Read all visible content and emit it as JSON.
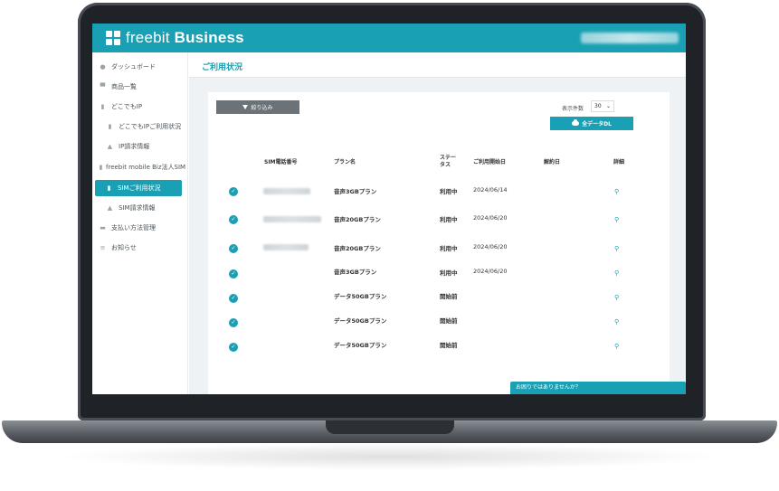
{
  "app": {
    "brand_light": "freebit",
    "brand_bold": "Business"
  },
  "sidebar": {
    "items": [
      {
        "label": "ダッシュボード",
        "icon": "dashboard-icon"
      },
      {
        "label": "商品一覧",
        "icon": "cart-icon"
      },
      {
        "label": "どこでもIP",
        "icon": "document-icon"
      },
      {
        "label": "どこでもIPご利用状況",
        "icon": "document-icon"
      },
      {
        "label": "IP請求情報",
        "icon": "coins-icon"
      },
      {
        "label": "freebit mobile Biz法人SIM",
        "icon": "document-icon"
      },
      {
        "label": "SIMご利用状況",
        "icon": "document-icon",
        "active": true
      },
      {
        "label": "SIM請求情報",
        "icon": "coins-icon"
      },
      {
        "label": "支払い方法管理",
        "icon": "card-icon"
      },
      {
        "label": "お知らせ",
        "icon": "list-icon"
      }
    ]
  },
  "page": {
    "title": "ご利用状況"
  },
  "toolbar": {
    "filter_label": "絞り込み",
    "perpage_label": "表示件数",
    "perpage_value": "30",
    "download_label": "全データDL"
  },
  "table": {
    "headers": {
      "phone": "SIM電話番号",
      "plan": "プラン名",
      "status_line1": "ステー",
      "status_line2": "タス",
      "start": "ご利用開始日",
      "end": "解約日",
      "detail": "詳細"
    },
    "rows": [
      {
        "plan": "音声3GBプラン",
        "status": "利用中",
        "start": "2024/06/14",
        "has_phone": true
      },
      {
        "plan": "音声20GBプラン",
        "status": "利用中",
        "start": "2024/06/20",
        "has_phone": true
      },
      {
        "plan": "音声20GBプラン",
        "status": "利用中",
        "start": "2024/06/20",
        "has_phone": true
      },
      {
        "plan": "音声3GBプラン",
        "status": "利用中",
        "start": "2024/06/20",
        "has_phone": false
      },
      {
        "plan": "データ50GBプラン",
        "status": "開始前",
        "start": "",
        "has_phone": false
      },
      {
        "plan": "データ50GBプラン",
        "status": "開始前",
        "start": "",
        "has_phone": false
      },
      {
        "plan": "データ50GBプラン",
        "status": "開始前",
        "start": "",
        "has_phone": false
      }
    ]
  },
  "help": {
    "label": "お困りではありませんか？"
  },
  "colors": {
    "accent": "#1aa0b4",
    "frame": "#1f2328"
  }
}
